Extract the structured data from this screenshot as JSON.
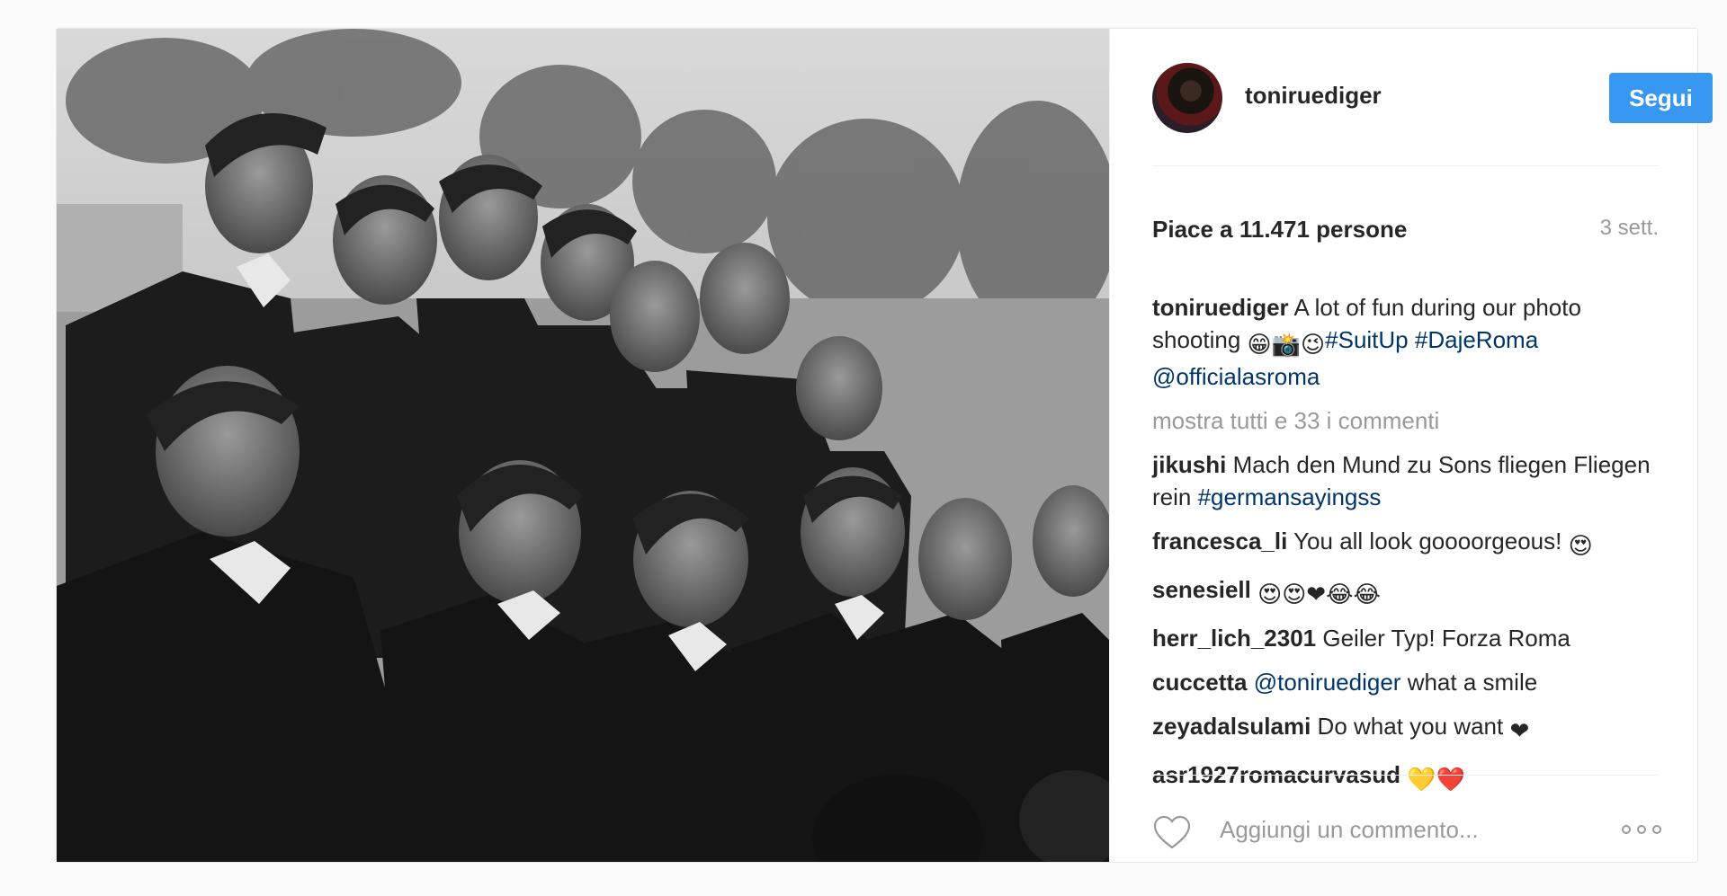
{
  "post": {
    "username": "toniruediger",
    "follow_label": "Segui",
    "likes": "Piace a 11.471 persone",
    "time": "3 sett.",
    "caption": {
      "user": "toniruediger",
      "text": "A lot of fun during our photo shooting",
      "emoji": "😁📸😉",
      "hashtags": [
        "#SuitUp",
        "#DajeRoma"
      ],
      "mention": "@officialasroma"
    },
    "show_all_comments": "mostra tutti e 33 i commenti",
    "comments": [
      {
        "user": "jikushi",
        "text": "Mach den Mund zu Sons fliegen Fliegen rein",
        "tag": "#germansayingss"
      },
      {
        "user": "francesca_li",
        "text": "You all look goooorgeous!",
        "emoji": "😍"
      },
      {
        "user": "senesiell",
        "emoji": "😍😍❤😂😂"
      },
      {
        "user": "herr_lich_2301",
        "text": "Geiler Typ! Forza Roma"
      },
      {
        "user": "cuccetta",
        "mention": "@toniruediger",
        "text": "what a smile"
      },
      {
        "user": "zeyadalsulami",
        "text": "Do what you want",
        "emoji": "❤"
      },
      {
        "user": "asr1927romacurvasud",
        "emoji": "💛❤️"
      }
    ],
    "comment_placeholder": "Aggiungi un commento..."
  },
  "colors": {
    "accent": "#3897f0",
    "link": "#003569",
    "muted": "#999999",
    "text": "#262626"
  },
  "icons": {
    "like": "heart-outline-icon",
    "more": "more-options-icon"
  }
}
